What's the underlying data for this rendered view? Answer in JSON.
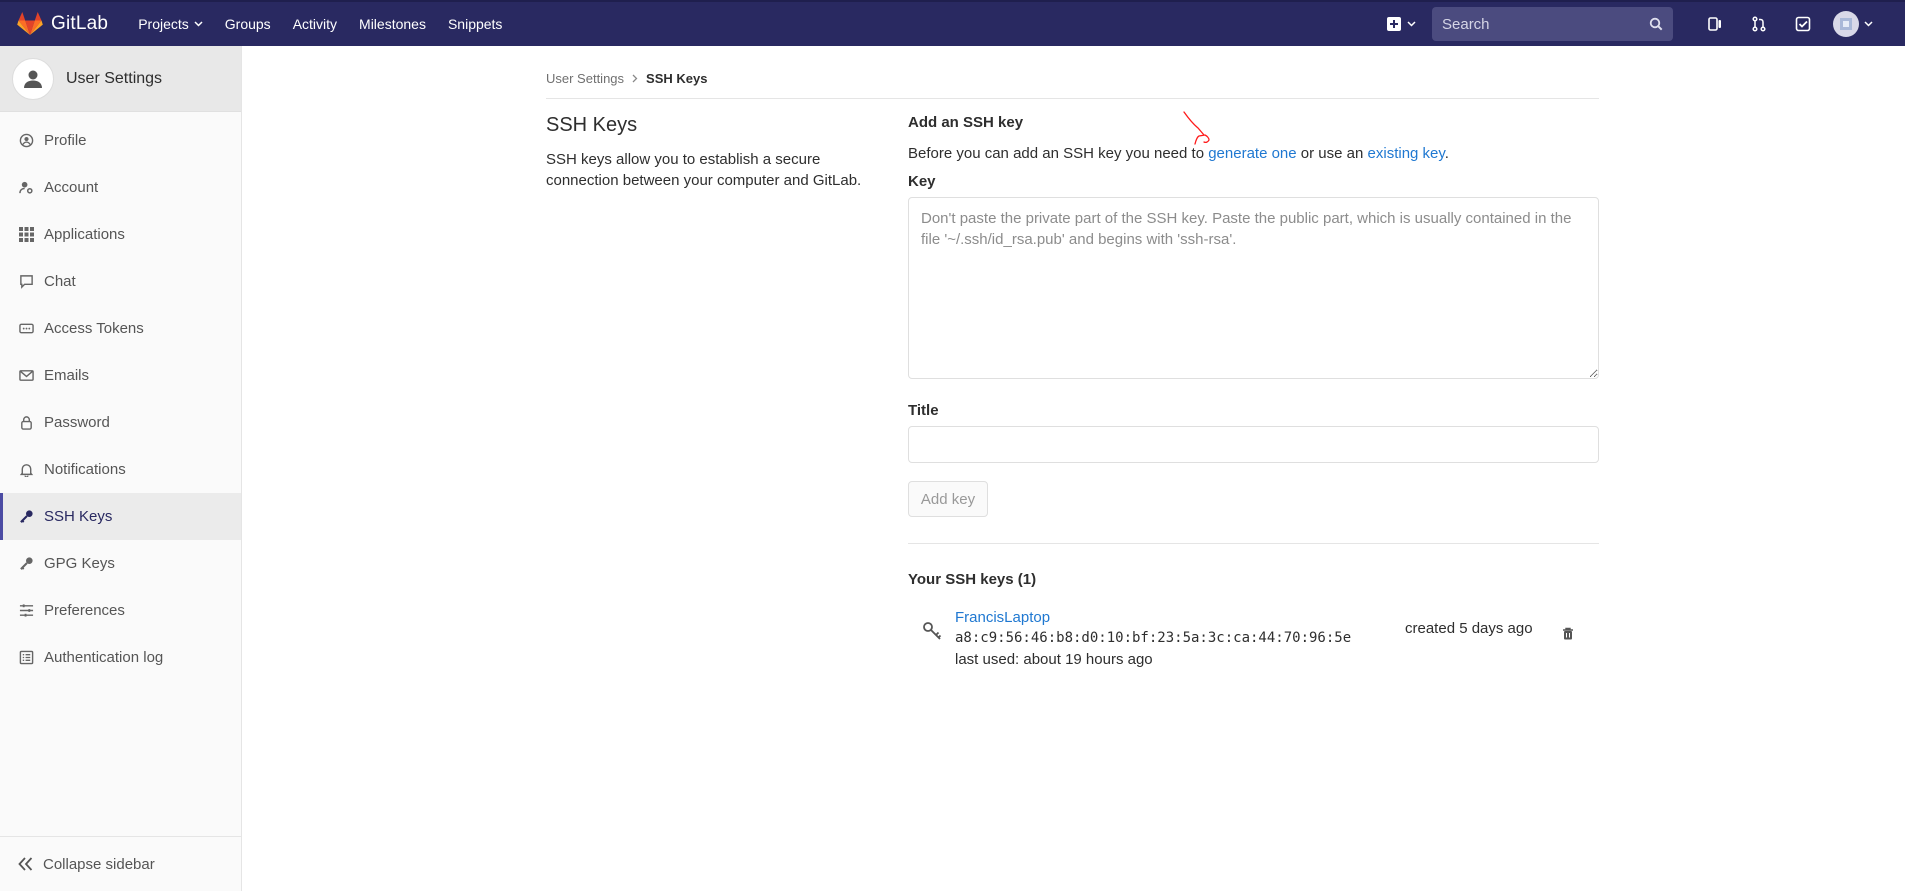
{
  "topbar": {
    "brand": "GitLab",
    "nav": [
      {
        "label": "Projects",
        "dropdown": true
      },
      {
        "label": "Groups"
      },
      {
        "label": "Activity"
      },
      {
        "label": "Milestones"
      },
      {
        "label": "Snippets"
      }
    ],
    "search_placeholder": "Search",
    "colors": {
      "bg": "#292961",
      "search_bg": "#4b4b7f"
    }
  },
  "sidebar": {
    "title": "User Settings",
    "items": [
      {
        "label": "Profile",
        "icon": "profile-icon"
      },
      {
        "label": "Account",
        "icon": "account-icon"
      },
      {
        "label": "Applications",
        "icon": "applications-icon"
      },
      {
        "label": "Chat",
        "icon": "chat-icon"
      },
      {
        "label": "Access Tokens",
        "icon": "access-tokens-icon"
      },
      {
        "label": "Emails",
        "icon": "envelope-icon"
      },
      {
        "label": "Password",
        "icon": "lock-icon"
      },
      {
        "label": "Notifications",
        "icon": "bell-icon"
      },
      {
        "label": "SSH Keys",
        "icon": "key-icon",
        "active": true
      },
      {
        "label": "GPG Keys",
        "icon": "key-icon"
      },
      {
        "label": "Preferences",
        "icon": "sliders-icon"
      },
      {
        "label": "Authentication log",
        "icon": "list-icon"
      }
    ],
    "collapse_label": "Collapse sidebar"
  },
  "breadcrumb": {
    "parent": "User Settings",
    "current": "SSH Keys"
  },
  "intro": {
    "title": "SSH Keys",
    "description": "SSH keys allow you to establish a secure connection between your computer and GitLab."
  },
  "form": {
    "heading": "Add an SSH key",
    "help_prefix": "Before you can add an SSH key you need to ",
    "help_link1": "generate one",
    "help_middle": " or use an ",
    "help_link2": "existing key",
    "help_suffix": ".",
    "key_label": "Key",
    "key_placeholder": "Don't paste the private part of the SSH key. Paste the public part, which is usually contained in the file '~/.ssh/id_rsa.pub' and begins with 'ssh-rsa'.",
    "key_value": "",
    "title_label": "Title",
    "title_value": "",
    "submit_label": "Add key"
  },
  "keys": {
    "heading": "Your SSH keys (1)",
    "items": [
      {
        "name": "FrancisLaptop",
        "fingerprint": "a8:c9:56:46:b8:d0:10:bf:23:5a:3c:ca:44:70:96:5e",
        "last_used": "last used: about 19 hours ago",
        "created": "created 5 days ago"
      }
    ]
  },
  "colors": {
    "link": "#1f78d1",
    "active_bar": "#4b4ba3",
    "annotation": "#ff0000"
  }
}
